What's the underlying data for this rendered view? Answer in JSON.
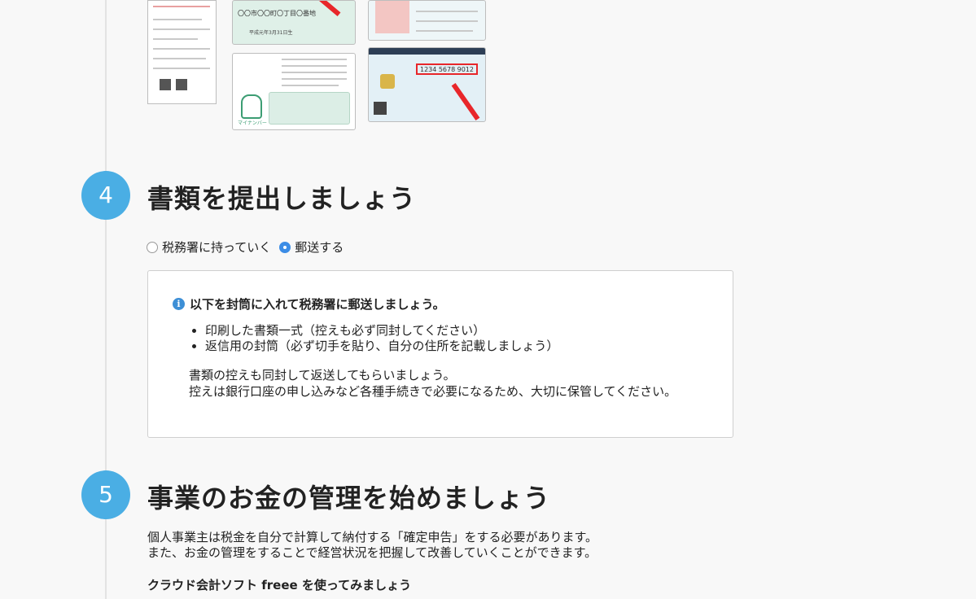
{
  "images": {
    "form_alt": "書類様式",
    "card_top_text": "〇〇市〇〇町〇丁目〇番地",
    "card_bottom_text": "平成元年3月31日生",
    "mynumber_digits": [
      "1234",
      "5678",
      "9012"
    ],
    "mascot_label": "マイナンバー"
  },
  "step4": {
    "number": "4",
    "title": "書類を提出しましょう",
    "radio_options": [
      {
        "label": "税務署に持っていく",
        "checked": false
      },
      {
        "label": "郵送する",
        "checked": true
      }
    ],
    "info": {
      "icon": "info-icon",
      "heading": "以下を封筒に入れて税務署に郵送しましょう。",
      "items": [
        "印刷した書類一式（控えも必ず同封してください）",
        "返信用の封筒（必ず切手を貼り、自分の住所を記載しましょう）"
      ],
      "note_line1": "書類の控えも同封して返送してもらいましょう。",
      "note_line2": "控えは銀行口座の申し込みなど各種手続きで必要になるため、大切に保管してください。"
    }
  },
  "step5": {
    "number": "5",
    "title": "事業のお金の管理を始めましょう",
    "line1": "個人事業主は税金を自分で計算して納付する「確定申告」をする必要があります。",
    "line2": "また、お金の管理をすることで経営状況を把握して改善していくことができます。",
    "subheading": "クラウド会計ソフト freee を使ってみましょう"
  },
  "colors": {
    "accent": "#4aaee4",
    "radio_checked": "#3c8de6",
    "arrow": "#e8262a"
  }
}
